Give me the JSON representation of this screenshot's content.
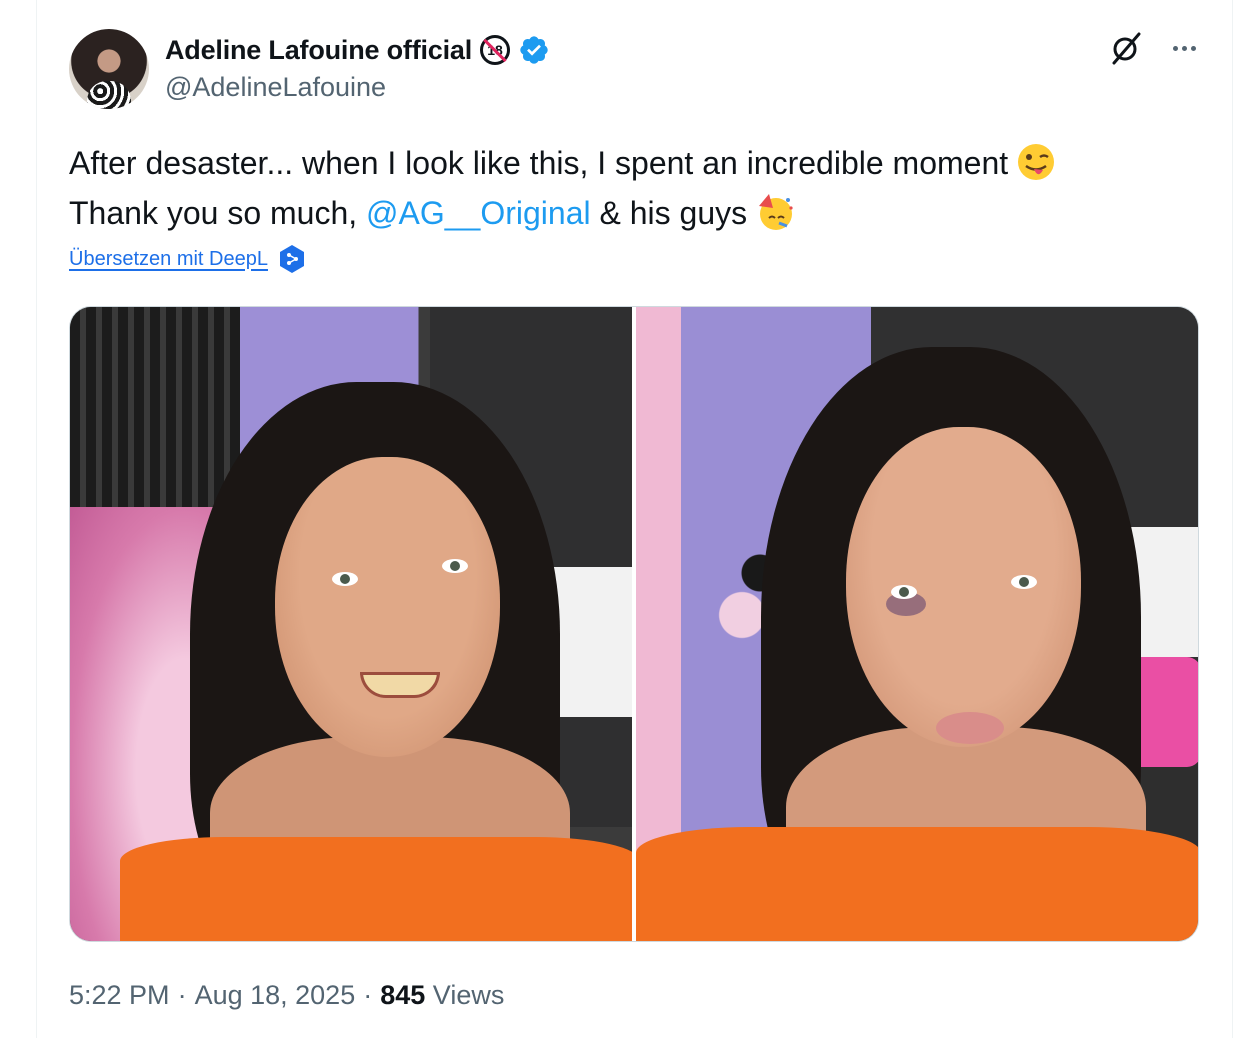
{
  "author": {
    "display_name": "Adeline Lafouine official",
    "handle": "@AdelineLafouine",
    "age_badge": "18"
  },
  "tweet": {
    "line1": "After desaster... when I look like this, I spent an incredible moment",
    "line1_emoji": "winking-face-with-tongue",
    "line2_before": "Thank you so much,",
    "mention": "@AG__Original",
    "line2_after": "& his guys",
    "line2_emoji": "partying-face"
  },
  "translate": {
    "label": "Übersetzen mit DeepL"
  },
  "media": {
    "photos": [
      "selfie-smiling",
      "selfie-bruised-eye"
    ]
  },
  "meta": {
    "time": "5:22 PM",
    "separator": "·",
    "date": "Aug 18, 2025",
    "views_count": "845",
    "views_label": "Views"
  },
  "colors": {
    "link": "#1d9bf0",
    "verified": "#1d9bf0",
    "text_secondary": "#536471",
    "shirt_orange": "#f26f1f"
  }
}
